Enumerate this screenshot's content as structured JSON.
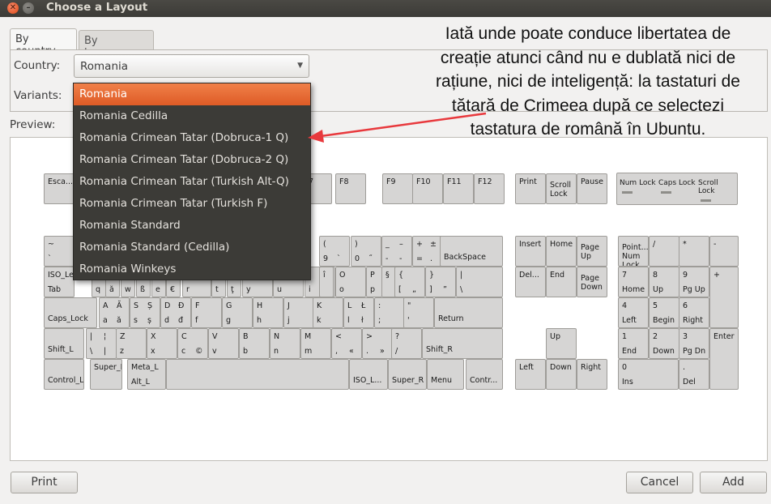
{
  "window": {
    "title": "Choose a Layout"
  },
  "tabs": [
    {
      "label": "By country"
    },
    {
      "label": "By language"
    }
  ],
  "form": {
    "country_label": "Country:",
    "country_value": "Romania",
    "variants_label": "Variants:",
    "preview_label": "Preview:"
  },
  "dropdown": {
    "items": [
      "Romania",
      "Romania Cedilla",
      "Romania Crimean Tatar (Dobruca-1 Q)",
      "Romania Crimean Tatar (Dobruca-2 Q)",
      "Romania Crimean Tatar (Turkish Alt-Q)",
      "Romania Crimean Tatar (Turkish F)",
      "Romania Standard",
      "Romania Standard (Cedilla)",
      "Romania Winkeys"
    ],
    "selected_index": 0
  },
  "annotation": {
    "text": "Iată unde poate conduce libertatea de creație atunci când nu e dublată nici de rațiune, nici de inteligență: la tastaturi de tătară de Crimeea după ce selectezi tastatura de română în Ubuntu."
  },
  "indicators": [
    {
      "label": "Num Lock"
    },
    {
      "label": "Caps Lock"
    },
    {
      "label": "Scroll Lock"
    }
  ],
  "keys": [
    {
      "t": "Esca..."
    },
    {
      "t": "7"
    },
    {
      "t": "F8"
    },
    {
      "t": "F9"
    },
    {
      "t": "F10"
    },
    {
      "t": "F11"
    },
    {
      "t": "F12"
    },
    {
      "t": "Print"
    },
    {
      "t": "Scroll Lock"
    },
    {
      "t": "Pause"
    },
    {
      "t": "~",
      "b": "`"
    },
    {
      "t": "(",
      "b": "9",
      "br": "`"
    },
    {
      "t": ")",
      "b": "0",
      "br": "˝"
    },
    {
      "t": "_",
      "tr": "–",
      "b": "-",
      "br": "-"
    },
    {
      "t": "+",
      "tr": "±",
      "b": "=",
      "br": "."
    },
    {
      "t": "BackSpace"
    },
    {
      "t": "Insert"
    },
    {
      "t": "Home"
    },
    {
      "t": "Page Up"
    },
    {
      "t": "Point... Num Lock"
    },
    {
      "t": "/"
    },
    {
      "t": "*"
    },
    {
      "t": "-"
    },
    {
      "t": "ISO_Le...",
      "b": "Tab"
    },
    {
      "b": "q"
    },
    {
      "b": "ă"
    },
    {
      "b": "w"
    },
    {
      "b": "ß"
    },
    {
      "b": "e"
    },
    {
      "b": "€"
    },
    {
      "b": "r"
    },
    {
      "b": "t"
    },
    {
      "b": "ţ"
    },
    {
      "b": "y"
    },
    {
      "b": "u"
    },
    {
      "t": "Î",
      "b": "i"
    },
    {
      "t": "î"
    },
    {
      "t": "O",
      "b": "o"
    },
    {
      "t": "P",
      "b": "p"
    },
    {
      "t": "§"
    },
    {
      "t": "{",
      "b": "[",
      "br": "„"
    },
    {
      "t": "}",
      "b": "]",
      "br": "”"
    },
    {
      "t": "|",
      "b": "\\"
    },
    {
      "t": "Del..."
    },
    {
      "t": "End"
    },
    {
      "t": "Page Down"
    },
    {
      "t": "7",
      "b": "Home"
    },
    {
      "t": "8",
      "b": "Up"
    },
    {
      "t": "9",
      "b": "Pg Up"
    },
    {
      "t": "+"
    },
    {
      "t": "Caps_Lock"
    },
    {
      "t": "A",
      "tr": "Ă",
      "b": "a",
      "br": "ă"
    },
    {
      "t": "S",
      "tr": "Ș",
      "b": "s",
      "br": "ș"
    },
    {
      "t": "D",
      "tr": "Đ",
      "b": "d",
      "br": "đ"
    },
    {
      "t": "F",
      "b": "f"
    },
    {
      "t": "G",
      "b": "g"
    },
    {
      "t": "H",
      "b": "h"
    },
    {
      "t": "J",
      "b": "j"
    },
    {
      "t": "K",
      "b": "k"
    },
    {
      "t": "L",
      "tr": "Ł",
      "b": "l",
      "br": "ł"
    },
    {
      "t": ":",
      "b": ";"
    },
    {
      "t": "\"",
      "b": "'"
    },
    {
      "t": "Return"
    },
    {
      "t": "4",
      "b": "Left"
    },
    {
      "t": "5",
      "b": "Begin"
    },
    {
      "t": "6",
      "b": "Right"
    },
    {
      "t": "Shift_L"
    },
    {
      "t": "|",
      "tr": "¦",
      "b": "\\",
      "br": "|"
    },
    {
      "t": "Z",
      "b": "z"
    },
    {
      "t": "X",
      "b": "x"
    },
    {
      "t": "C",
      "b": "c",
      "br": "©"
    },
    {
      "t": "V",
      "b": "v"
    },
    {
      "t": "B",
      "b": "b"
    },
    {
      "t": "N",
      "b": "n"
    },
    {
      "t": "M",
      "b": "m"
    },
    {
      "t": "<",
      "b": ",",
      "br": "«"
    },
    {
      "t": ">",
      "b": ".",
      "br": "»"
    },
    {
      "t": "?",
      "b": "/"
    },
    {
      "t": "Shift_R"
    },
    {
      "t": "Up"
    },
    {
      "t": "1",
      "b": "End"
    },
    {
      "t": "2",
      "b": "Down"
    },
    {
      "t": "3",
      "b": "Pg Dn"
    },
    {
      "t": "Enter"
    },
    {
      "t": "Control_L"
    },
    {
      "t": "Super_L"
    },
    {
      "t": "Meta_L",
      "b": "Alt_L"
    },
    {
      "t": ""
    },
    {
      "t": "ISO_L..."
    },
    {
      "t": "Super_R"
    },
    {
      "t": "Menu"
    },
    {
      "t": "Contr..."
    },
    {
      "t": "Left"
    },
    {
      "t": "Down"
    },
    {
      "t": "Right"
    },
    {
      "t": "0",
      "b": "Ins"
    },
    {
      "t": ".",
      "b": "Del"
    }
  ],
  "buttons": {
    "print": "Print",
    "cancel": "Cancel",
    "add": "Add"
  }
}
